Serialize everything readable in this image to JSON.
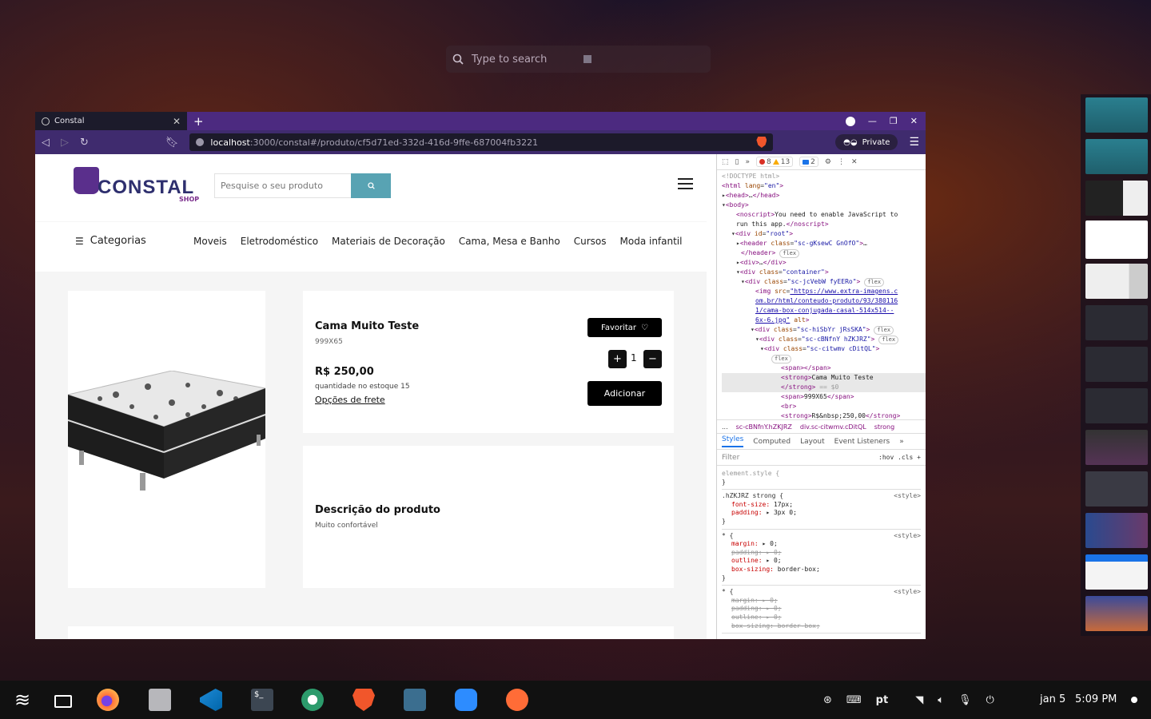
{
  "desktop": {
    "search_placeholder": "Type to search"
  },
  "browser": {
    "tab_title": "Constal",
    "new_tab_symbol": "+",
    "url_host": "localhost",
    "url_rest": ":3000/constal#/produto/cf5d71ed-332d-416d-9ffe-687004fb3221",
    "private_label": "Private"
  },
  "site": {
    "logo_text": "CONSTAL",
    "logo_sub": "SHOP",
    "search_placeholder": "Pesquise o seu produto",
    "categories_label": "Categorias",
    "categories": [
      "Moveis",
      "Eletrodoméstico",
      "Materiais de Decoração",
      "Cama, Mesa e Banho",
      "Cursos",
      "Moda infantil"
    ]
  },
  "product": {
    "name": "Cama Muito Teste",
    "size": "999X65",
    "price": "R$ 250,00",
    "stock": "quantidade no estoque 15",
    "shipping_link": "Opções de frete",
    "favorite_label": "Favoritar",
    "quantity": "1",
    "plus": "+",
    "minus": "−",
    "add_label": "Adicionar",
    "description_title": "Descrição do produto",
    "description_text": "Muito confortável"
  },
  "devtools": {
    "errors": "8",
    "warnings": "13",
    "messages": "2",
    "breadcrumbs": [
      "...",
      "sc-cBNfnY.hZKJRZ",
      "div.sc-citwmv.cDitQL",
      "strong"
    ],
    "tabs": [
      "Styles",
      "Computed",
      "Layout",
      "Event Listeners",
      "»"
    ],
    "filter_placeholder": "Filter",
    "filter_tools": ":hov .cls +"
  },
  "taskbar": {
    "lang": "pt",
    "date": "jan 5",
    "time": "5:09 PM"
  },
  "colors": {
    "accent_search": "#58a3b3",
    "brave_orange": "#f1562b",
    "tabbar": "#4c2a80"
  }
}
